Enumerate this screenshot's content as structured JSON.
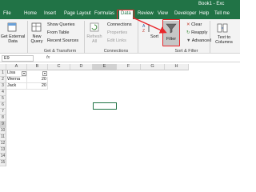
{
  "window": {
    "title": "Book1 - Exc"
  },
  "tabs": [
    "File",
    "Home",
    "Insert",
    "Page Layout",
    "Formulas",
    "Data",
    "Review",
    "View",
    "Developer",
    "Help",
    "Tell me"
  ],
  "active_tab": "Data",
  "ribbon": {
    "get_external_data": "Get External Data",
    "new_query": "New Query",
    "show_queries": "Show Queries",
    "from_table": "From Table",
    "recent_sources": "Recent Sources",
    "get_transform_label": "Get & Transform",
    "refresh_all": "Refresh All",
    "connections": "Connections",
    "properties": "Properties",
    "edit_links": "Edit Links",
    "connections_label": "Connections",
    "sort": "Sort",
    "filter": "Filter",
    "clear": "Clear",
    "reapply": "Reapply",
    "advanced": "Advanced",
    "sort_filter_label": "Sort & Filter",
    "text_to_columns": "Text to Columns"
  },
  "formula_bar": {
    "name_box": "E9",
    "fx": "fx"
  },
  "columns": [
    "A",
    "B",
    "C",
    "D",
    "E",
    "F",
    "G",
    "H"
  ],
  "rows": [
    "1",
    "2",
    "3",
    "4",
    "5",
    "6",
    "7",
    "8",
    "9",
    "10",
    "11",
    "12",
    "13",
    "14",
    "15"
  ],
  "cells": {
    "A1": "Lisa",
    "A2": "Werna",
    "A3": "Jack",
    "B2": "20",
    "B3": "20"
  },
  "colors": {
    "accent": "#217346",
    "highlight": "#e8262b"
  }
}
